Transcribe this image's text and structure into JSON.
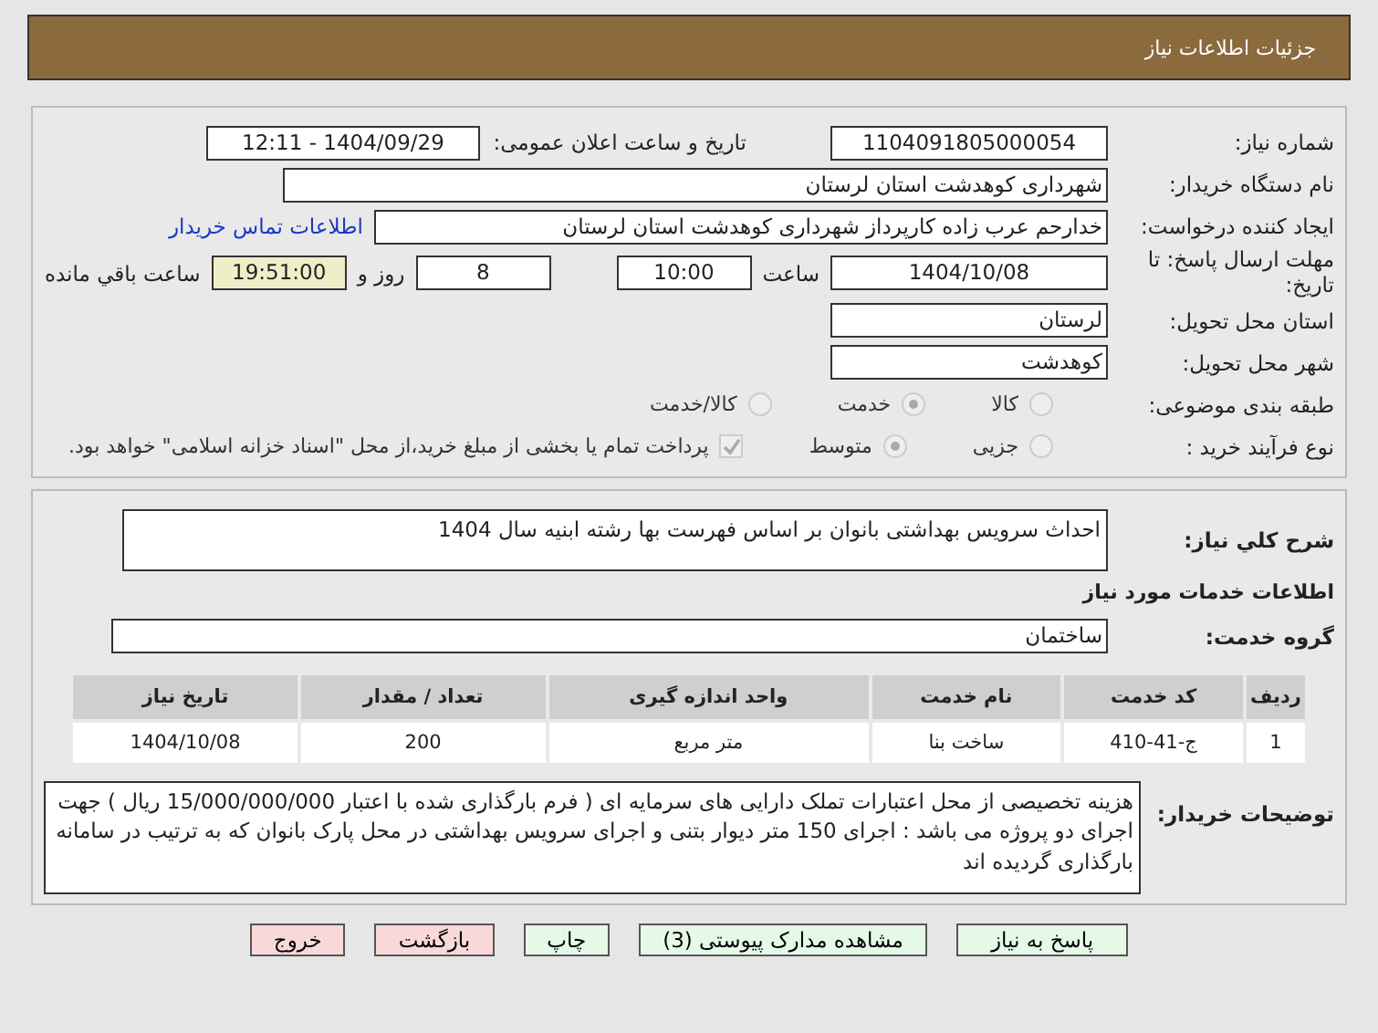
{
  "header": {
    "title": "جزئیات اطلاعات نیاز"
  },
  "need_number": {
    "label": "شماره نیاز:",
    "value": "1104091805000054"
  },
  "announce": {
    "label": "تاریخ و ساعت اعلان عمومی:",
    "value": "1404/09/29 - 12:11"
  },
  "buyer": {
    "label": "نام دستگاه خریدار:",
    "value": "شهرداری کوهدشت استان لرستان"
  },
  "creator": {
    "label": "ایجاد کننده درخواست:",
    "value": "خدارحم عرب زاده کارپرداز شهرداری کوهدشت استان لرستان",
    "link": "اطلاعات تماس خریدار"
  },
  "deadline": {
    "label": "مهلت ارسال پاسخ: تا تاریخ:",
    "date": "1404/10/08",
    "time_label": "ساعت",
    "time": "10:00",
    "days": "8",
    "days_label": "روز و",
    "remaining": "19:51:00",
    "remaining_label": "ساعت باقي مانده"
  },
  "province": {
    "label": "استان محل تحویل:",
    "value": "لرستان"
  },
  "city": {
    "label": "شهر محل تحویل:",
    "value": "کوهدشت"
  },
  "category": {
    "label": "طبقه بندی موضوعی:",
    "options": [
      {
        "label": "کالا",
        "selected": false
      },
      {
        "label": "خدمت",
        "selected": true
      },
      {
        "label": "کالا/خدمت",
        "selected": false
      }
    ]
  },
  "process": {
    "label": "نوع فرآیند خرید :",
    "options": [
      {
        "label": "جزیی",
        "selected": false
      },
      {
        "label": "متوسط",
        "selected": true
      }
    ],
    "payment": {
      "checked": true,
      "text": "پرداخت تمام یا بخشی از مبلغ خرید،از محل \"اسناد خزانه اسلامی\" خواهد بود."
    }
  },
  "summary": {
    "label": "شرح کلي نیاز:",
    "value": "احداث سرویس بهداشتی بانوان بر اساس فهرست بها رشته ابنیه سال 1404"
  },
  "services_heading": "اطلاعات خدمات مورد نیاز",
  "service_group": {
    "label": "گروه خدمت:",
    "value": "ساختمان"
  },
  "table": {
    "columns": [
      "ردیف",
      "کد خدمت",
      "نام خدمت",
      "واحد اندازه گیری",
      "تعداد / مقدار",
      "تاریخ نیاز"
    ],
    "rows": [
      [
        "1",
        "ج-41-410",
        "ساخت بنا",
        "متر مربع",
        "200",
        "1404/10/08"
      ]
    ]
  },
  "buyer_notes": {
    "label": "توضیحات خریدار:",
    "value": "هزینه تخصیصی از محل اعتبارات تملک دارایی های سرمایه ای ( فرم بارگذاری شده با اعتبار 15/000/000/000 ریال ) جهت اجرای دو پروژه می باشد : اجرای 150 متر دیوار بتنی و اجرای سرویس بهداشتی در محل پارک بانوان که به ترتیب در سامانه بارگذاری گردیده اند"
  },
  "buttons": [
    {
      "label": "پاسخ به نیاز",
      "kind": "green"
    },
    {
      "label": "مشاهده مدارک پیوستی (3)",
      "kind": "green"
    },
    {
      "label": "چاپ",
      "kind": "green"
    },
    {
      "label": "بازگشت",
      "kind": "red"
    },
    {
      "label": "خروج",
      "kind": "red"
    }
  ]
}
